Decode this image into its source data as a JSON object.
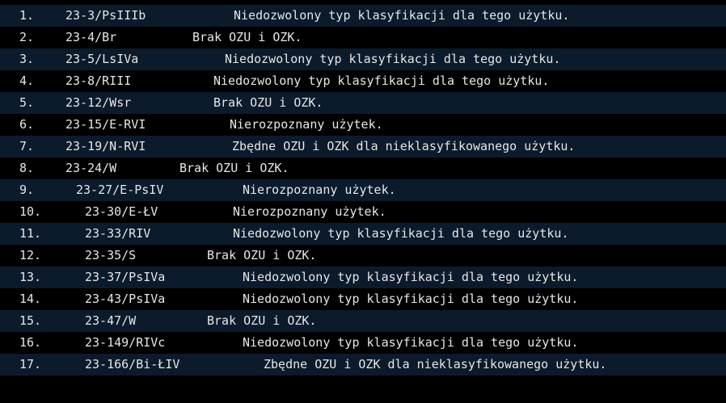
{
  "rows": [
    {
      "num": "1.",
      "code": "23-3/PsIIIb",
      "msg": "Niedozwolony typ klasyfikacji dla tego użytku."
    },
    {
      "num": "2.",
      "code": "23-4/Br",
      "msg": "Brak OZU i OZK."
    },
    {
      "num": "3.",
      "code": "23-5/LsIVa",
      "msg": "Niedozwolony typ klasyfikacji dla tego użytku."
    },
    {
      "num": "4.",
      "code": "23-8/RIII",
      "msg": "Niedozwolony typ klasyfikacji dla tego użytku."
    },
    {
      "num": "5.",
      "code": "23-12/Wsr",
      "msg": "Brak OZU i OZK."
    },
    {
      "num": "6.",
      "code": "23-15/E-RVI",
      "msg": "Nierozpoznany użytek."
    },
    {
      "num": "7.",
      "code": "23-19/N-RVI",
      "msg": "Zbędne OZU i OZK dla nieklasyfikowanego użytku."
    },
    {
      "num": "8.",
      "code": "23-24/W",
      "msg": "Brak OZU i OZK."
    },
    {
      "num": "9.",
      "code": "23-27/E-PsIV",
      "msg": "Nierozpoznany użytek."
    },
    {
      "num": "10.",
      "code": "23-30/E-ŁV",
      "msg": "Nierozpoznany użytek."
    },
    {
      "num": "11.",
      "code": "23-33/RIV",
      "msg": "Niedozwolony typ klasyfikacji dla tego użytku."
    },
    {
      "num": "12.",
      "code": "23-35/S",
      "msg": "Brak OZU i OZK."
    },
    {
      "num": "13.",
      "code": "23-37/PsIVa",
      "msg": "Niedozwolony typ klasyfikacji dla tego użytku."
    },
    {
      "num": "14.",
      "code": "23-43/PsIVa",
      "msg": "Niedozwolony typ klasyfikacji dla tego użytku."
    },
    {
      "num": "15.",
      "code": "23-47/W",
      "msg": "Brak OZU i OZK."
    },
    {
      "num": "16.",
      "code": "23-149/RIVc",
      "msg": "Niedozwolony typ klasyfikacji dla tego użytku."
    },
    {
      "num": "17.",
      "code": "23-166/Bi-ŁIV",
      "msg": "Zbędne OZU i OZK dla nieklasyfikowanego użytku."
    }
  ]
}
